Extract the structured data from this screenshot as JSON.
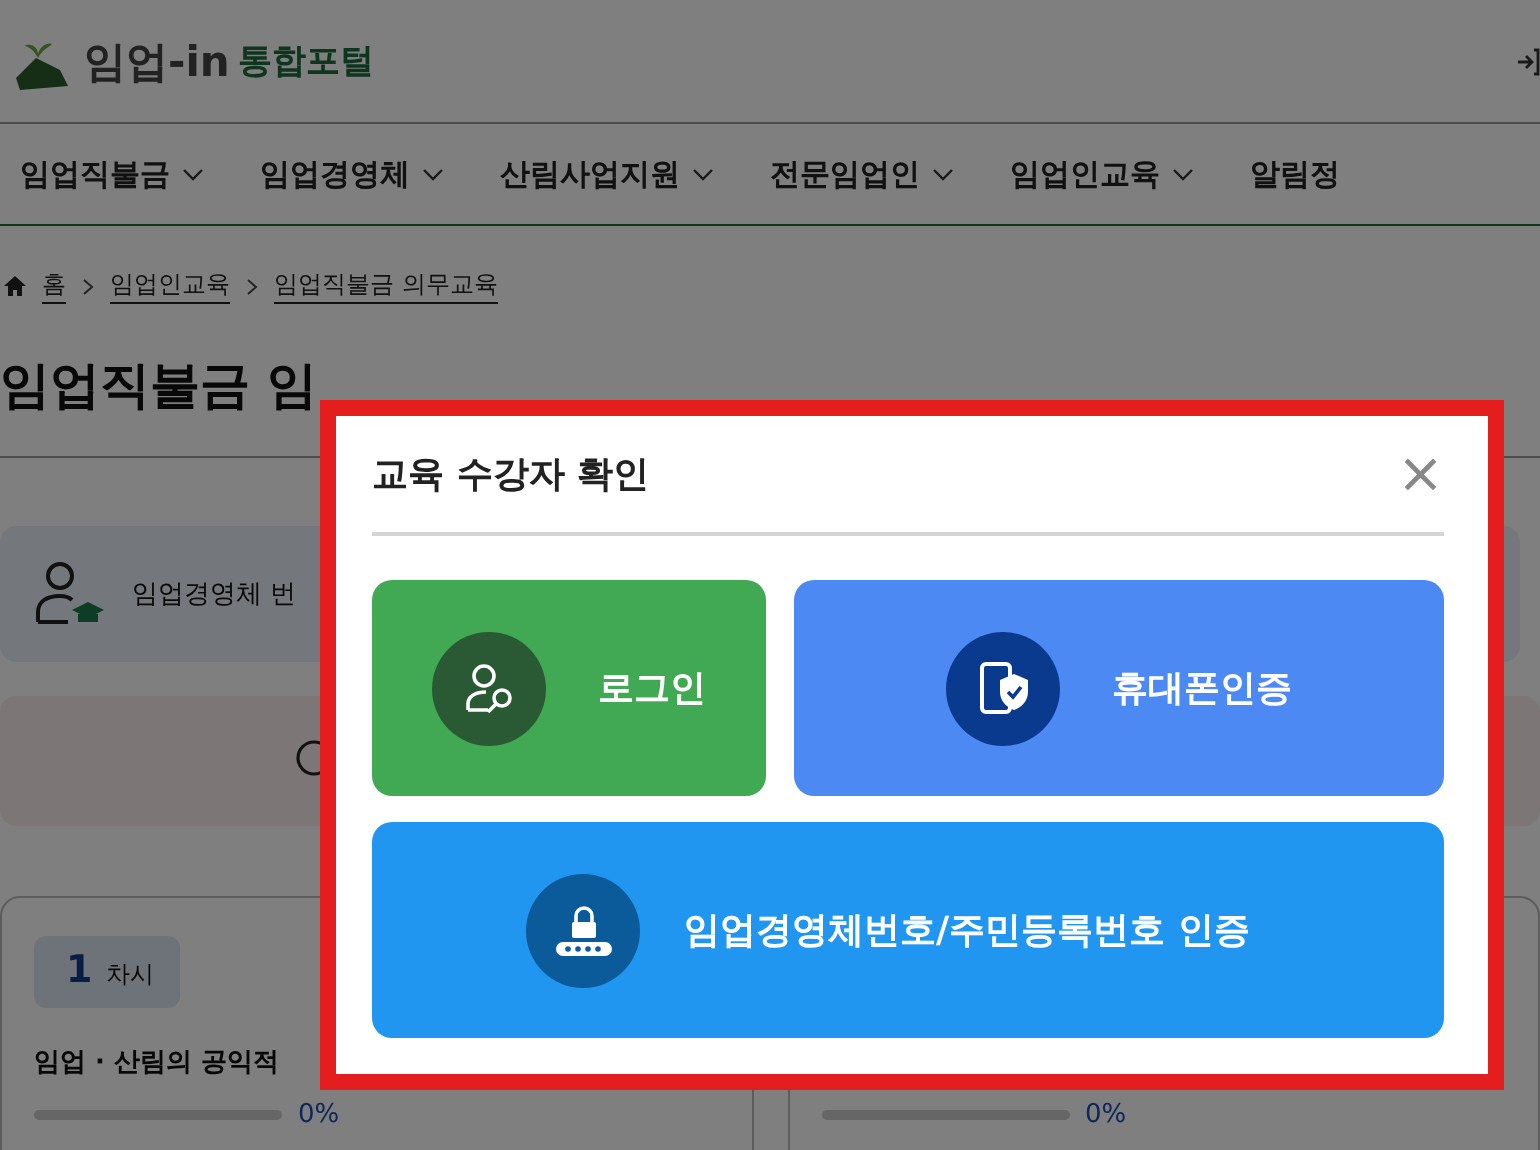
{
  "header": {
    "logo_text": "임업-in",
    "logo_sub": "통합포털"
  },
  "nav": [
    {
      "label": "임업직불금",
      "expandable": true
    },
    {
      "label": "임업경영체",
      "expandable": true
    },
    {
      "label": "산림사업지원",
      "expandable": true
    },
    {
      "label": "전문임업인",
      "expandable": true
    },
    {
      "label": "임업인교육",
      "expandable": true
    },
    {
      "label": "알림정",
      "expandable": false
    }
  ],
  "breadcrumb": [
    "홈",
    "임업인교육",
    "임업직불금 의무교육"
  ],
  "page_title": "임업직불금 임",
  "notice": {
    "text": "임업경영체 번"
  },
  "lessons": [
    {
      "number": "1",
      "unit": "차시",
      "title": "임업 · 산림의 공익적",
      "level": 0,
      "reading": "0%"
    },
    {
      "level": 0,
      "reading": "0%"
    }
  ],
  "modal": {
    "title": "교육 수강자 확인",
    "close": "×",
    "options": [
      {
        "kind": "login",
        "label": "로그인",
        "color": "#41a854"
      },
      {
        "kind": "phone",
        "label": "휴대폰인증",
        "color": "#4d89f3"
      },
      {
        "kind": "number",
        "label": "임업경영체번호/주민등록번호 인증",
        "color": "#2196f0"
      }
    ]
  }
}
